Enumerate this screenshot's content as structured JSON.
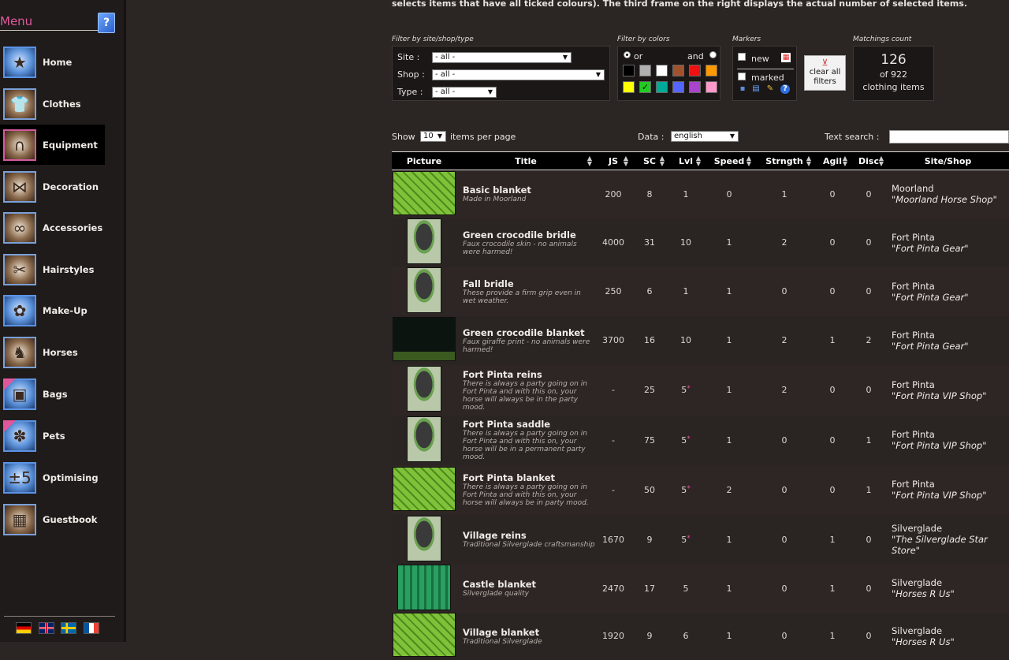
{
  "sidebar": {
    "title": "Menu",
    "items": [
      {
        "label": "Home",
        "icon": "star-icon",
        "glyph": "★"
      },
      {
        "label": "Clothes",
        "icon": "shirt-icon",
        "glyph": "👕"
      },
      {
        "label": "Equipment",
        "icon": "horseshoe-icon",
        "glyph": "∩"
      },
      {
        "label": "Decoration",
        "icon": "bow-icon",
        "glyph": "⋈"
      },
      {
        "label": "Accessories",
        "icon": "glasses-icon",
        "glyph": "∞"
      },
      {
        "label": "Hairstyles",
        "icon": "scissors-icon",
        "glyph": "✂"
      },
      {
        "label": "Make-Up",
        "icon": "makeup-icon",
        "glyph": "✿"
      },
      {
        "label": "Horses",
        "icon": "horse-icon",
        "glyph": "♞"
      },
      {
        "label": "Bags",
        "icon": "bag-icon",
        "glyph": "▣"
      },
      {
        "label": "Pets",
        "icon": "paw-icon",
        "glyph": "✽"
      },
      {
        "label": "Optimising",
        "icon": "optimising-icon",
        "glyph": "±5"
      },
      {
        "label": "Guestbook",
        "icon": "guestbook-icon",
        "glyph": "▦"
      }
    ],
    "active_index": 2,
    "languages": [
      "de",
      "en",
      "sv",
      "fr"
    ]
  },
  "intro_text": "selects items that have all ticked colours). The third frame on the right displays the actual number of selected items.",
  "filters": {
    "site_shop_type_label": "Filter by site/shop/type",
    "site_label": "Site :",
    "site_value": "- all -",
    "shop_label": "Shop :",
    "shop_value": "- all -",
    "type_label": "Type :",
    "type_value": "- all -",
    "colors_label": "Filter by colors",
    "or_label": "or",
    "and_label": "and",
    "mode": "or",
    "colors_row1": [
      "#000000",
      "#b0b0b0",
      "#ffffff",
      "#a0522d",
      "#ee1111",
      "#ff9900"
    ],
    "colors_row2": [
      "#ffff00",
      "#22cc22",
      "#00aa99",
      "#5566ff",
      "#aa44cc",
      "#ff99cc"
    ],
    "checked_color_index_row2": 1,
    "check_mark": "✓",
    "markers_label": "Markers",
    "new_label": "new",
    "marked_label": "marked",
    "clear_button": "clear all filters"
  },
  "matching": {
    "label": "Matchings count",
    "count": "126",
    "of_text": "of 922",
    "unit": "clothing items"
  },
  "controls": {
    "show_label": "Show",
    "per_page_value": "10",
    "per_page_suffix": "items per page",
    "data_label": "Data :",
    "data_value": "english",
    "search_label": "Text search :",
    "search_value": ""
  },
  "table": {
    "headers": [
      "Picture",
      "Title",
      "JS",
      "SC",
      "Lvl",
      "Speed",
      "Strngth",
      "Agil",
      "Disc",
      "Site/Shop"
    ],
    "rows": [
      {
        "name": "Basic blanket",
        "desc": "Made in Moorland",
        "js": "200",
        "sc": "8",
        "lvl": "1",
        "star": "",
        "speed": "0",
        "strength": "1",
        "agil": "0",
        "disc": "0",
        "site": "Moorland",
        "shop": "\"Moorland Horse Shop\"",
        "thumb": "blanket"
      },
      {
        "name": "Green crocodile bridle",
        "desc": "Faux crocodile skin - no animals were harmed!",
        "js": "4000",
        "sc": "31",
        "lvl": "10",
        "star": "",
        "speed": "1",
        "strength": "2",
        "agil": "0",
        "disc": "0",
        "site": "Fort Pinta",
        "shop": "\"Fort Pinta Gear\"",
        "thumb": "horse"
      },
      {
        "name": "Fall bridle",
        "desc": "These provide a firm grip even in wet weather.",
        "js": "250",
        "sc": "6",
        "lvl": "1",
        "star": "",
        "speed": "1",
        "strength": "0",
        "agil": "0",
        "disc": "0",
        "site": "Fort Pinta",
        "shop": "\"Fort Pinta Gear\"",
        "thumb": "horse"
      },
      {
        "name": "Green crocodile blanket",
        "desc": "Faux giraffe print - no animals were harmed!",
        "js": "3700",
        "sc": "16",
        "lvl": "10",
        "star": "",
        "speed": "1",
        "strength": "2",
        "agil": "1",
        "disc": "2",
        "site": "Fort Pinta",
        "shop": "\"Fort Pinta Gear\"",
        "thumb": "darkblanket"
      },
      {
        "name": "Fort Pinta reins",
        "desc": "There is always a party going on in Fort Pinta and with this on, your horse will always be in the party mood.",
        "js": "-",
        "sc": "25",
        "lvl": "5",
        "star": "*",
        "speed": "1",
        "strength": "2",
        "agil": "0",
        "disc": "0",
        "site": "Fort Pinta",
        "shop": "\"Fort Pinta VIP Shop\"",
        "thumb": "horse"
      },
      {
        "name": "Fort Pinta saddle",
        "desc": "There is always a party going on in Fort Pinta and with this on, your horse will be in a permanent party mood.",
        "js": "-",
        "sc": "75",
        "lvl": "5",
        "star": "*",
        "speed": "1",
        "strength": "0",
        "agil": "0",
        "disc": "1",
        "site": "Fort Pinta",
        "shop": "\"Fort Pinta VIP Shop\"",
        "thumb": "horse"
      },
      {
        "name": "Fort Pinta blanket",
        "desc": "There is always a party going on in Fort Pinta and with this on, your horse will always be in party mood.",
        "js": "-",
        "sc": "50",
        "lvl": "5",
        "star": "*",
        "speed": "2",
        "strength": "0",
        "agil": "0",
        "disc": "1",
        "site": "Fort Pinta",
        "shop": "\"Fort Pinta VIP Shop\"",
        "thumb": "blanket"
      },
      {
        "name": "Village reins",
        "desc": "Traditional Silverglade craftsmanship",
        "js": "1670",
        "sc": "9",
        "lvl": "5",
        "star": "*",
        "speed": "1",
        "strength": "0",
        "agil": "1",
        "disc": "0",
        "site": "Silverglade",
        "shop": "\"The Silverglade Star Store\"",
        "thumb": "horse"
      },
      {
        "name": "Castle blanket",
        "desc": "Silverglade quality",
        "js": "2470",
        "sc": "17",
        "lvl": "5",
        "star": "",
        "speed": "1",
        "strength": "0",
        "agil": "1",
        "disc": "0",
        "site": "Silverglade",
        "shop": "\"Horses R Us\"",
        "thumb": "tealblanket"
      },
      {
        "name": "Village blanket",
        "desc": "Traditional Silverglade",
        "js": "1920",
        "sc": "9",
        "lvl": "6",
        "star": "",
        "speed": "1",
        "strength": "0",
        "agil": "1",
        "disc": "0",
        "site": "Silverglade",
        "shop": "\"Horses R Us\"",
        "thumb": "blanket"
      }
    ]
  }
}
